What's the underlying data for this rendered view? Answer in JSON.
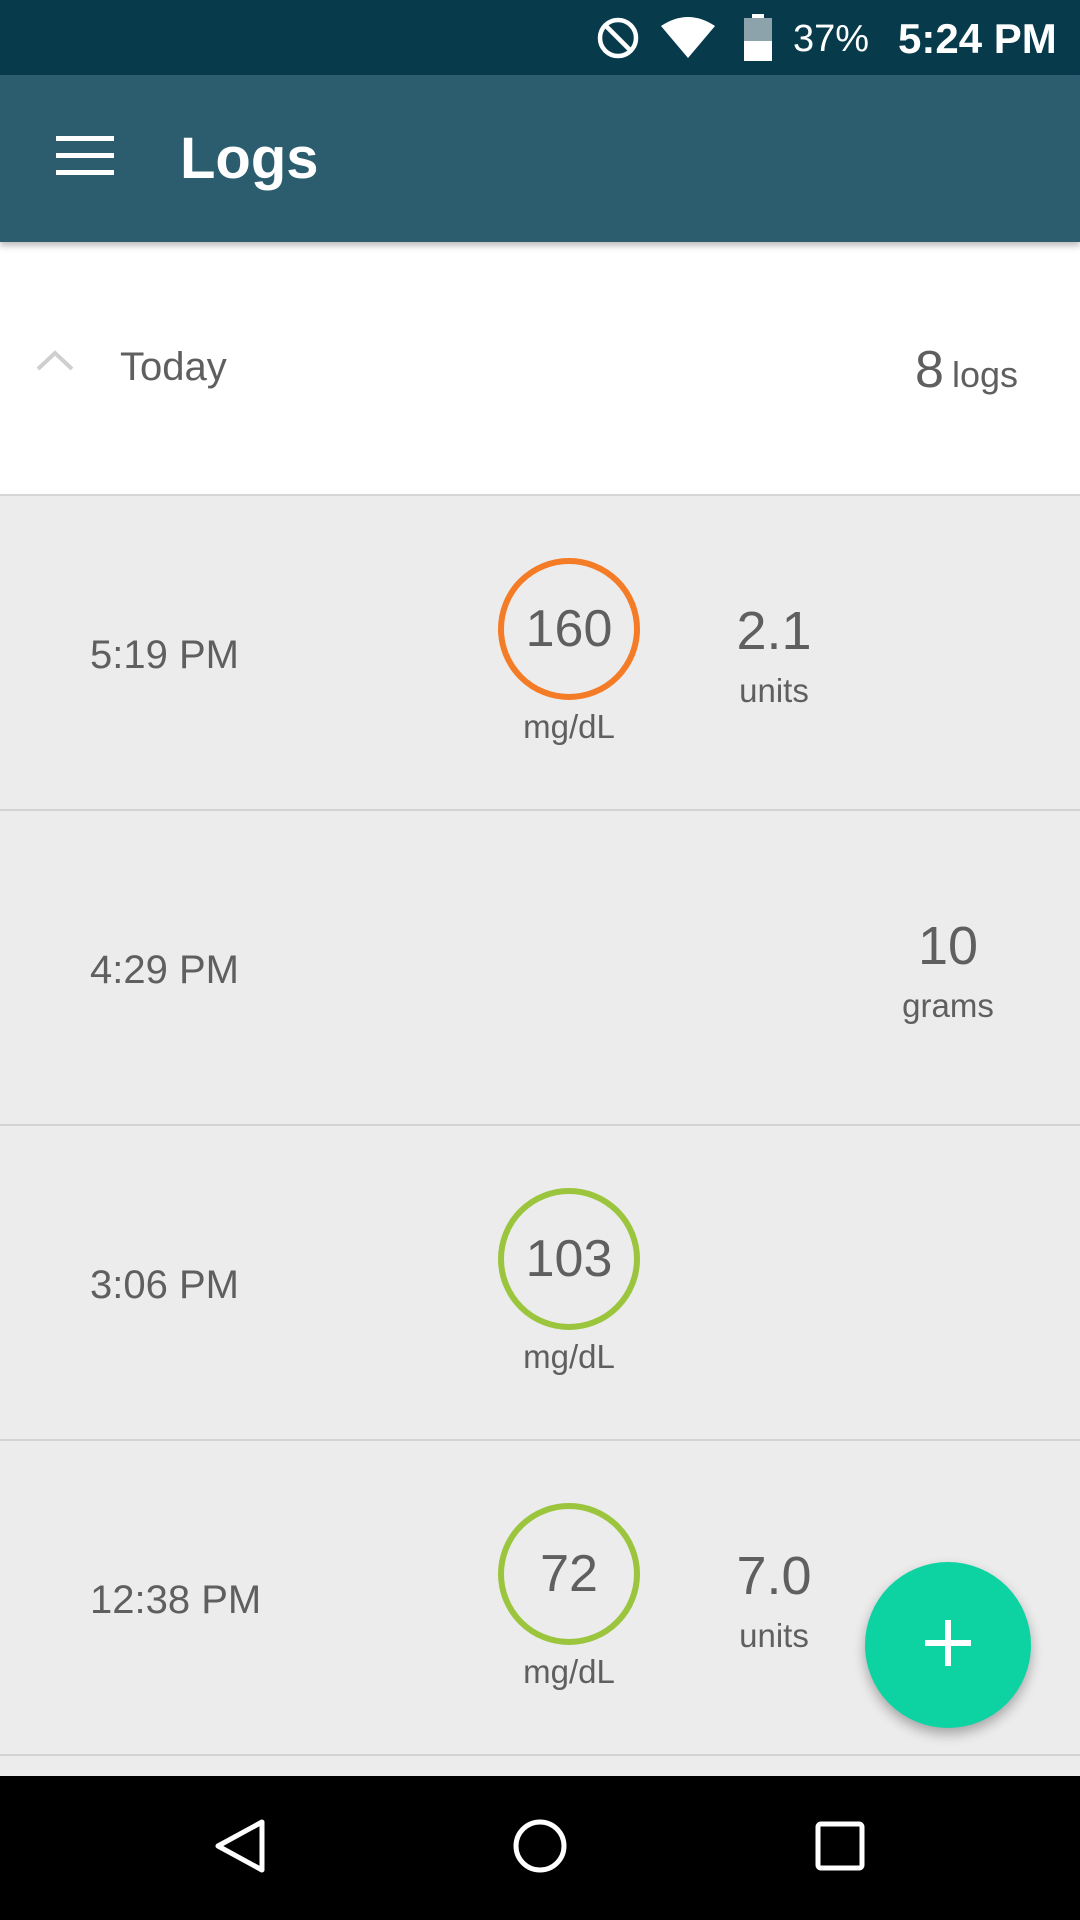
{
  "status_bar": {
    "battery_percent": "37%",
    "time": "5:24 PM",
    "icons": [
      "do-not-disturb-icon",
      "wifi-icon",
      "battery-icon"
    ]
  },
  "app_bar": {
    "title": "Logs",
    "menu_icon": "hamburger-menu-icon",
    "background": "#2b5d6e"
  },
  "day_group": {
    "label": "Today",
    "count": "8",
    "count_unit": "logs",
    "expanded": true
  },
  "logs": [
    {
      "time": "5:19 PM",
      "glucose": "160",
      "glucose_unit": "mg/dL",
      "glucose_color": "#f47c26",
      "insulin": "2.1",
      "insulin_unit": "units"
    },
    {
      "time": "4:29 PM",
      "carbs": "10",
      "carbs_unit": "grams"
    },
    {
      "time": "3:06 PM",
      "glucose": "103",
      "glucose_unit": "mg/dL",
      "glucose_color": "#9bc53d"
    },
    {
      "time": "12:38 PM",
      "glucose": "72",
      "glucose_unit": "mg/dL",
      "glucose_color": "#9bc53d",
      "insulin": "7.0",
      "insulin_unit": "units"
    }
  ],
  "fab": {
    "icon": "plus-icon",
    "color": "#0dd3a2"
  },
  "nav_bar": {
    "icons": [
      "back-icon",
      "home-icon",
      "recents-icon"
    ]
  }
}
